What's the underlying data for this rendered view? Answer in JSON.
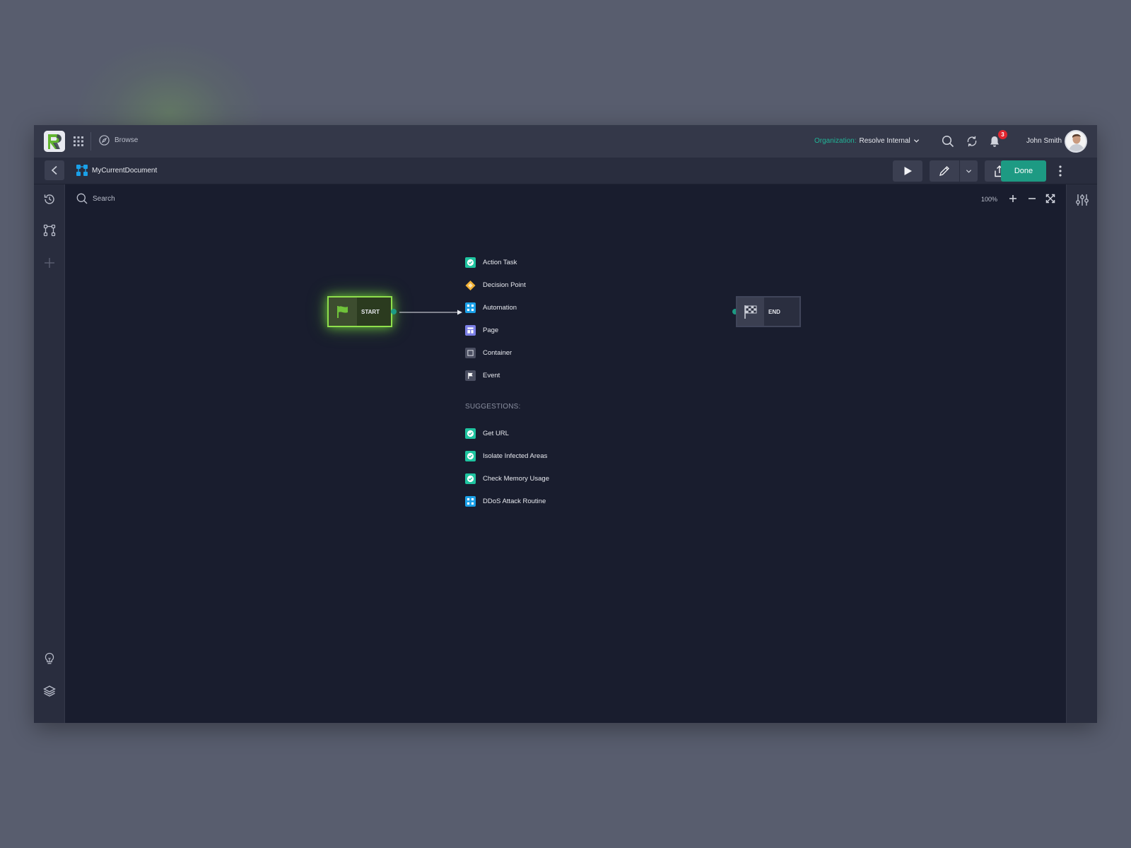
{
  "topbar": {
    "browse_label": "Browse",
    "org_label": "Organization:",
    "org_value": "Resolve Internal",
    "notification_count": "3",
    "user_name": "John Smith"
  },
  "subbar": {
    "document_title": "MyCurrentDocument",
    "done_label": "Done"
  },
  "canvas": {
    "search_placeholder": "Search",
    "zoom_level": "100%"
  },
  "nodes": {
    "start_label": "START",
    "end_label": "END"
  },
  "menu": {
    "items": [
      {
        "label": "Action Task",
        "icon": "check-badge-icon",
        "color": "#1fc4a0"
      },
      {
        "label": "Decision Point",
        "icon": "diamond-icon",
        "color": "#f2b136"
      },
      {
        "label": "Automation",
        "icon": "automation-icon",
        "color": "#1aa0e8"
      },
      {
        "label": "Page",
        "icon": "page-icon",
        "color": "#7b7fe6"
      },
      {
        "label": "Container",
        "icon": "container-icon",
        "color": "#4a4e61"
      },
      {
        "label": "Event",
        "icon": "flag-icon",
        "color": "#4a4e61"
      }
    ],
    "suggestions_heading": "SUGGESTIONS:",
    "suggestions": [
      {
        "label": "Get URL",
        "icon": "check-badge-icon",
        "color": "#1fc4a0"
      },
      {
        "label": "Isolate Infected Areas",
        "icon": "check-badge-icon",
        "color": "#1fc4a0"
      },
      {
        "label": "Check Memory Usage",
        "icon": "check-badge-icon",
        "color": "#1fc4a0"
      },
      {
        "label": "DDoS Attack Routine",
        "icon": "automation-icon",
        "color": "#1aa0e8"
      }
    ]
  },
  "colors": {
    "accent": "#1d9a83",
    "start_glow": "#8fe04c",
    "canvas_bg": "#191d2e"
  }
}
